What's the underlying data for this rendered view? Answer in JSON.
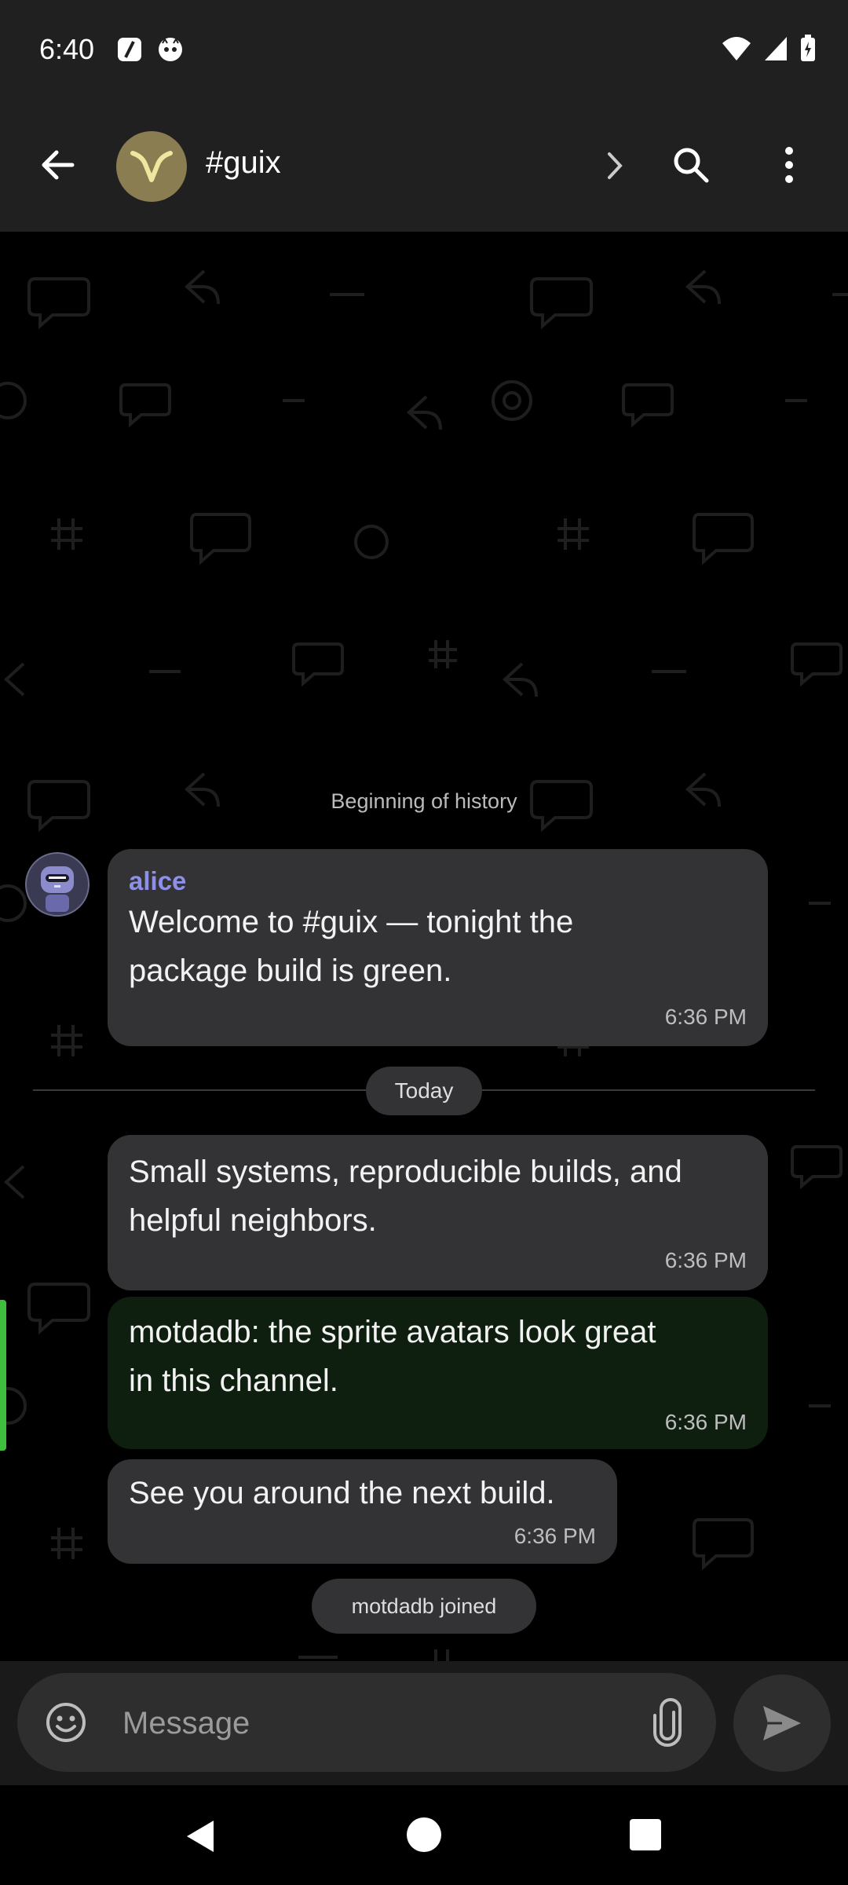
{
  "status_bar": {
    "time": "6:40",
    "left_icons": [
      "feather-app-icon",
      "cat-app-icon"
    ],
    "right_icons": [
      "wifi-icon",
      "cell-signal-icon",
      "battery-charging-icon"
    ]
  },
  "header": {
    "channel_name": "#guix",
    "avatar_icon": "horns-logo-icon",
    "accent": "#8a7d52"
  },
  "chat": {
    "history_label": "Beginning of history",
    "messages": [
      {
        "sender": "alice",
        "text_lines": [
          "Welcome to #guix — tonight the",
          "package build is green."
        ],
        "time": "6:36 PM"
      },
      {
        "text_lines": [
          "Small systems, reproducible builds, and",
          "helpful neighbors."
        ],
        "time": "6:36 PM"
      },
      {
        "text_lines": [
          "motdadb: the sprite avatars look great",
          "in this channel."
        ],
        "time": "6:36 PM",
        "highlighted": true
      },
      {
        "text_lines": [
          "See you around the next build."
        ],
        "time": "6:36 PM"
      }
    ],
    "date_divider": "Today",
    "event_joined": "motdadb joined"
  },
  "composer": {
    "placeholder": "Message"
  },
  "colors": {
    "background": "#000000",
    "bar": "#202020",
    "bubble": "#333335",
    "highlight_bubble": "#0f1f0f",
    "highlight_bar": "#3ec03e",
    "sender_name": "#8e90e8"
  }
}
